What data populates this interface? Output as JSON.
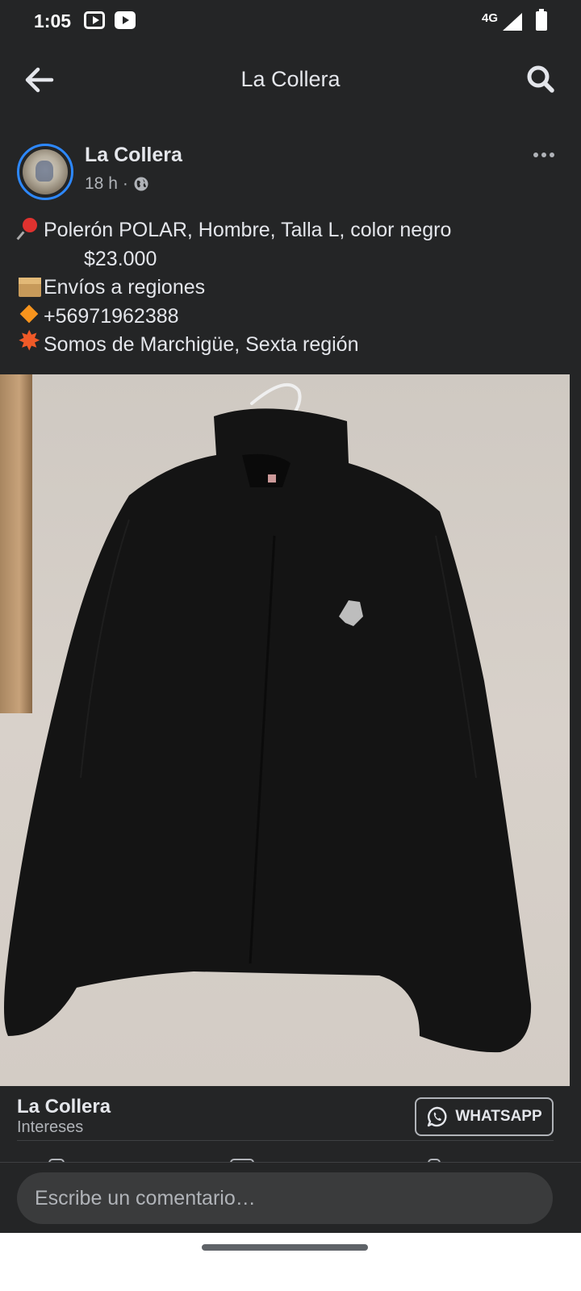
{
  "status_bar": {
    "time": "1:05",
    "network": "4G",
    "notification_icons": [
      "youtube-outline-icon",
      "youtube-icon"
    ]
  },
  "header": {
    "title": "La Collera",
    "back_icon": "arrow-left-icon",
    "search_icon": "search-icon"
  },
  "post": {
    "author": "La Collera",
    "time_ago": "18 h",
    "separator": "·",
    "audience_icon": "globe-icon",
    "text_lines": [
      {
        "emoji": "pushpin",
        "text": "Polerón POLAR, Hombre, Talla L, color negro"
      },
      {
        "emoji": "",
        "text": "$23.000"
      },
      {
        "emoji": "package",
        "text": "Envíos a regiones"
      },
      {
        "emoji": "orange-diamond",
        "text": "+56971962388"
      },
      {
        "emoji": "collision",
        "text": "Somos de Marchigüe, Sexta región"
      }
    ],
    "photo_description": "black fleece jacket on hanger"
  },
  "link_card": {
    "title": "La Collera",
    "subtitle": "Intereses",
    "button_label": "WHATSAPP"
  },
  "comment": {
    "placeholder": "Escribe un comentario…"
  },
  "colors": {
    "background": "#242526",
    "text": "#e4e6eb",
    "secondary_text": "#b0b3b8",
    "accent": "#2d88ff",
    "input_bg": "#3a3b3c"
  }
}
